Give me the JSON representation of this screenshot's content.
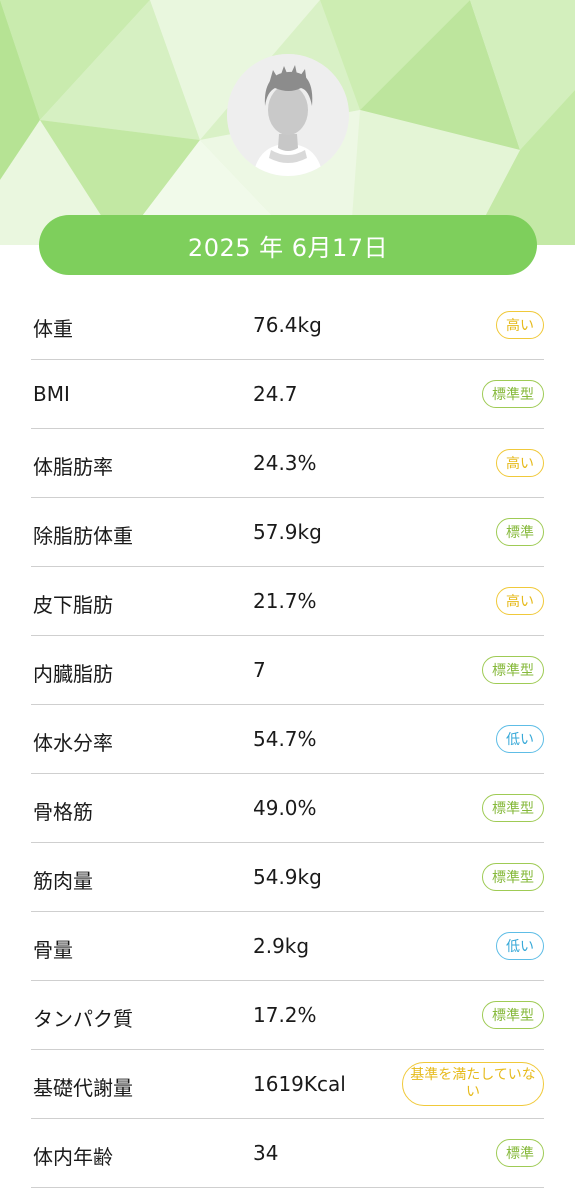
{
  "header": {
    "date": "2025 年 6月17日"
  },
  "metrics": [
    {
      "label": "体重",
      "value": "76.4kg",
      "status": "高い",
      "status_type": "high"
    },
    {
      "label": "BMI",
      "value": "24.7",
      "status": "標準型",
      "status_type": "std"
    },
    {
      "label": "体脂肪率",
      "value": "24.3%",
      "status": "高い",
      "status_type": "high"
    },
    {
      "label": "除脂肪体重",
      "value": "57.9kg",
      "status": "標準",
      "status_type": "std"
    },
    {
      "label": "皮下脂肪",
      "value": "21.7%",
      "status": "高い",
      "status_type": "high"
    },
    {
      "label": "内臓脂肪",
      "value": "7",
      "status": "標準型",
      "status_type": "std"
    },
    {
      "label": "体水分率",
      "value": "54.7%",
      "status": "低い",
      "status_type": "low"
    },
    {
      "label": "骨格筋",
      "value": "49.0%",
      "status": "標準型",
      "status_type": "std"
    },
    {
      "label": "筋肉量",
      "value": "54.9kg",
      "status": "標準型",
      "status_type": "std"
    },
    {
      "label": "骨量",
      "value": "2.9kg",
      "status": "低い",
      "status_type": "low"
    },
    {
      "label": "タンパク質",
      "value": "17.2%",
      "status": "標準型",
      "status_type": "std"
    },
    {
      "label": "基礎代謝量",
      "value": "1619Kcal",
      "status": "基準を満たしていない",
      "status_type": "unmet"
    },
    {
      "label": "体内年齢",
      "value": "34",
      "status": "標準",
      "status_type": "std"
    }
  ],
  "colors": {
    "accent_green": "#7ecf5c",
    "status_high": "#e6ba1b",
    "status_standard": "#86b93b",
    "status_low": "#38a9d8"
  },
  "icons": {
    "avatar": "person-silhouette-icon"
  }
}
